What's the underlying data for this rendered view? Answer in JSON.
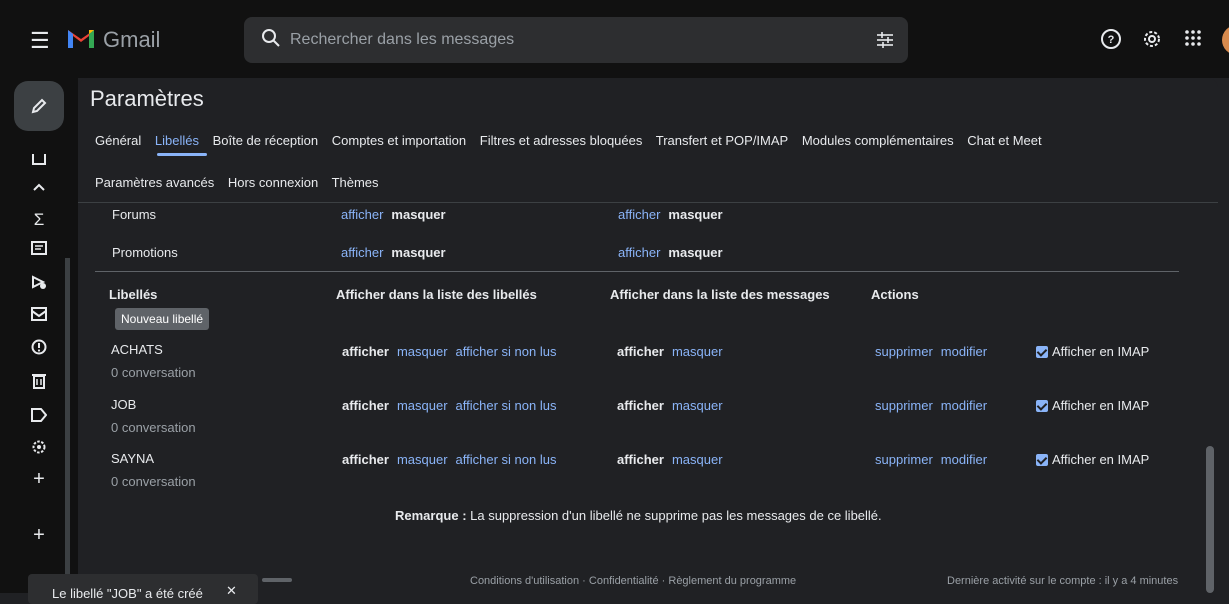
{
  "header": {
    "app_name": "Gmail",
    "search_placeholder": "Rechercher dans les messages"
  },
  "page": {
    "title": "Paramètres",
    "tabs_row1": [
      "Général",
      "Libellés",
      "Boîte de réception",
      "Comptes et importation",
      "Filtres et adresses bloquées",
      "Transfert et POP/IMAP",
      "Modules complémentaires",
      "Chat et Meet"
    ],
    "tabs_row2": [
      "Paramètres avancés",
      "Hors connexion",
      "Thèmes"
    ],
    "active_tab": "Libellés"
  },
  "categories": [
    {
      "name": "Forums",
      "show": "afficher",
      "hide": "masquer",
      "msg_show": "afficher",
      "msg_hide": "masquer"
    },
    {
      "name": "Promotions",
      "show": "afficher",
      "hide": "masquer",
      "msg_show": "afficher",
      "msg_hide": "masquer"
    }
  ],
  "labels_table": {
    "headers": [
      "Libellés",
      "Afficher dans la liste des libellés",
      "Afficher dans la liste des messages",
      "Actions"
    ],
    "new_label_tooltip": "Nouveau libellé",
    "rows": [
      {
        "name": "ACHATS",
        "count": "0 conversation",
        "show": "afficher",
        "hide": "masquer",
        "unread": "afficher si non lus",
        "msg_show": "afficher",
        "msg_hide": "masquer",
        "delete": "supprimer",
        "edit": "modifier",
        "imap": "Afficher en IMAP"
      },
      {
        "name": "JOB",
        "count": "0 conversation",
        "show": "afficher",
        "hide": "masquer",
        "unread": "afficher si non lus",
        "msg_show": "afficher",
        "msg_hide": "masquer",
        "delete": "supprimer",
        "edit": "modifier",
        "imap": "Afficher en IMAP"
      },
      {
        "name": "SAYNA",
        "count": "0 conversation",
        "show": "afficher",
        "hide": "masquer",
        "unread": "afficher si non lus",
        "msg_show": "afficher",
        "msg_hide": "masquer",
        "delete": "supprimer",
        "edit": "modifier",
        "imap": "Afficher en IMAP"
      }
    ]
  },
  "note": {
    "bold": "Remarque :",
    "text": " La suppression d'un libellé ne supprime pas les messages de ce libellé."
  },
  "footer": {
    "links": "Conditions d'utilisation · Confidentialité · Règlement du programme",
    "activity": "Dernière activité sur le compte : il y a 4 minutes"
  },
  "toast": {
    "text": "Le libellé \"JOB\" a été créé",
    "close": "✕"
  },
  "colors": {
    "background": "#202124",
    "link": "#8ab4f8",
    "checkbox": "#8ab4f8"
  }
}
